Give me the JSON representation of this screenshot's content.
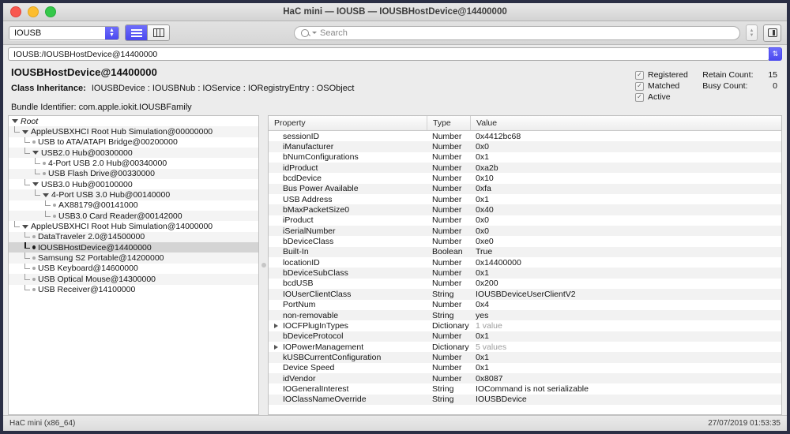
{
  "window": {
    "title": "HaC mini — IOUSB — IOUSBHostDevice@14400000",
    "close_label": "",
    "minimize_label": "",
    "zoom_label": ""
  },
  "toolbar": {
    "plane_value": "IOUSB",
    "stepper_glyph": "⌃⌄",
    "view_list_icon": "list-view-icon",
    "view_column_icon": "column-view-icon",
    "search_placeholder": "Search",
    "search_value": "",
    "search_icon": "search-icon",
    "stepper_icon": "stepper-icon",
    "sidebar_toggle_icon": "sidebar-toggle-icon"
  },
  "pathbar": {
    "path": "IOUSB:/IOUSBHostDevice@14400000",
    "refresh_glyph": "⇅"
  },
  "info": {
    "device_title": "IOUSBHostDevice@14400000",
    "class_inheritance_label": "Class Inheritance:",
    "class_inheritance_value": "IOUSBDevice : IOUSBNub : IOService : IORegistryEntry : OSObject",
    "bundle_label": "Bundle Identifier:",
    "bundle_value": "com.apple.iokit.IOUSBFamily",
    "flags": [
      {
        "label": "Registered",
        "checked": true
      },
      {
        "label": "Matched",
        "checked": true
      },
      {
        "label": "Active",
        "checked": true
      }
    ],
    "counts": [
      {
        "label": "Retain Count:",
        "value": "15"
      },
      {
        "label": "Busy Count:",
        "value": "0"
      }
    ],
    "check_glyph": "✓"
  },
  "tree": {
    "items": [
      {
        "label": "Root",
        "depth": 0,
        "kind": "root",
        "expanded": true,
        "selected": false
      },
      {
        "label": "AppleUSBXHCI Root Hub Simulation@00000000",
        "depth": 1,
        "kind": "branch",
        "expanded": true,
        "selected": false
      },
      {
        "label": "USB to ATA/ATAPI Bridge@00200000",
        "depth": 2,
        "kind": "leaf",
        "expanded": false,
        "selected": false
      },
      {
        "label": "USB2.0 Hub@00300000",
        "depth": 2,
        "kind": "branch",
        "expanded": true,
        "selected": false
      },
      {
        "label": "4-Port USB 2.0 Hub@00340000",
        "depth": 3,
        "kind": "leaf",
        "expanded": false,
        "selected": false
      },
      {
        "label": "USB Flash Drive@00330000",
        "depth": 3,
        "kind": "leaf",
        "expanded": false,
        "selected": false
      },
      {
        "label": "USB3.0 Hub@00100000",
        "depth": 2,
        "kind": "branch",
        "expanded": true,
        "selected": false
      },
      {
        "label": "4-Port USB 3.0 Hub@00140000",
        "depth": 3,
        "kind": "branch",
        "expanded": true,
        "selected": false
      },
      {
        "label": "AX88179@00141000",
        "depth": 4,
        "kind": "leaf",
        "expanded": false,
        "selected": false
      },
      {
        "label": "USB3.0 Card Reader@00142000",
        "depth": 4,
        "kind": "leaf",
        "expanded": false,
        "selected": false
      },
      {
        "label": "AppleUSBXHCI Root Hub Simulation@14000000",
        "depth": 1,
        "kind": "branch",
        "expanded": true,
        "selected": false
      },
      {
        "label": "DataTraveler 2.0@14500000",
        "depth": 2,
        "kind": "leaf",
        "expanded": false,
        "selected": false
      },
      {
        "label": "IOUSBHostDevice@14400000",
        "depth": 2,
        "kind": "leaf",
        "expanded": false,
        "selected": true
      },
      {
        "label": "Samsung S2 Portable@14200000",
        "depth": 2,
        "kind": "leaf",
        "expanded": false,
        "selected": false
      },
      {
        "label": "USB Keyboard@14600000",
        "depth": 2,
        "kind": "leaf",
        "expanded": false,
        "selected": false
      },
      {
        "label": "USB Optical Mouse@14300000",
        "depth": 2,
        "kind": "leaf",
        "expanded": false,
        "selected": false
      },
      {
        "label": "USB Receiver@14100000",
        "depth": 2,
        "kind": "leaf",
        "expanded": false,
        "selected": false
      }
    ]
  },
  "properties": {
    "columns": [
      "Property",
      "Type",
      "Value"
    ],
    "rows": [
      {
        "property": "sessionID",
        "type": "Number",
        "value": "0x4412bc68",
        "expandable": false,
        "dim": false
      },
      {
        "property": "iManufacturer",
        "type": "Number",
        "value": "0x0",
        "expandable": false,
        "dim": false
      },
      {
        "property": "bNumConfigurations",
        "type": "Number",
        "value": "0x1",
        "expandable": false,
        "dim": false
      },
      {
        "property": "idProduct",
        "type": "Number",
        "value": "0xa2b",
        "expandable": false,
        "dim": false
      },
      {
        "property": "bcdDevice",
        "type": "Number",
        "value": "0x10",
        "expandable": false,
        "dim": false
      },
      {
        "property": "Bus Power Available",
        "type": "Number",
        "value": "0xfa",
        "expandable": false,
        "dim": false
      },
      {
        "property": "USB Address",
        "type": "Number",
        "value": "0x1",
        "expandable": false,
        "dim": false
      },
      {
        "property": "bMaxPacketSize0",
        "type": "Number",
        "value": "0x40",
        "expandable": false,
        "dim": false
      },
      {
        "property": "iProduct",
        "type": "Number",
        "value": "0x0",
        "expandable": false,
        "dim": false
      },
      {
        "property": "iSerialNumber",
        "type": "Number",
        "value": "0x0",
        "expandable": false,
        "dim": false
      },
      {
        "property": "bDeviceClass",
        "type": "Number",
        "value": "0xe0",
        "expandable": false,
        "dim": false
      },
      {
        "property": "Built-In",
        "type": "Boolean",
        "value": "True",
        "expandable": false,
        "dim": false
      },
      {
        "property": "locationID",
        "type": "Number",
        "value": "0x14400000",
        "expandable": false,
        "dim": false
      },
      {
        "property": "bDeviceSubClass",
        "type": "Number",
        "value": "0x1",
        "expandable": false,
        "dim": false
      },
      {
        "property": "bcdUSB",
        "type": "Number",
        "value": "0x200",
        "expandable": false,
        "dim": false
      },
      {
        "property": "IOUserClientClass",
        "type": "String",
        "value": "IOUSBDeviceUserClientV2",
        "expandable": false,
        "dim": false
      },
      {
        "property": "PortNum",
        "type": "Number",
        "value": "0x4",
        "expandable": false,
        "dim": false
      },
      {
        "property": "non-removable",
        "type": "String",
        "value": "yes",
        "expandable": false,
        "dim": false
      },
      {
        "property": "IOCFPlugInTypes",
        "type": "Dictionary",
        "value": "1 value",
        "expandable": true,
        "dim": true
      },
      {
        "property": "bDeviceProtocol",
        "type": "Number",
        "value": "0x1",
        "expandable": false,
        "dim": false
      },
      {
        "property": "IOPowerManagement",
        "type": "Dictionary",
        "value": "5 values",
        "expandable": true,
        "dim": true
      },
      {
        "property": "kUSBCurrentConfiguration",
        "type": "Number",
        "value": "0x1",
        "expandable": false,
        "dim": false
      },
      {
        "property": "Device Speed",
        "type": "Number",
        "value": "0x1",
        "expandable": false,
        "dim": false
      },
      {
        "property": "idVendor",
        "type": "Number",
        "value": "0x8087",
        "expandable": false,
        "dim": false
      },
      {
        "property": "IOGeneralInterest",
        "type": "String",
        "value": "IOCommand is not serializable",
        "expandable": false,
        "dim": false
      },
      {
        "property": "IOClassNameOverride",
        "type": "String",
        "value": "IOUSBDevice",
        "expandable": false,
        "dim": false
      }
    ]
  },
  "status": {
    "left": "HaC mini (x86_64)",
    "right": "27/07/2019 01:53:35"
  },
  "colors": {
    "accent": "#5b59f2",
    "selection": "#d4d4d4",
    "chrome": "#ececec",
    "desktop": "#2b2f45"
  }
}
